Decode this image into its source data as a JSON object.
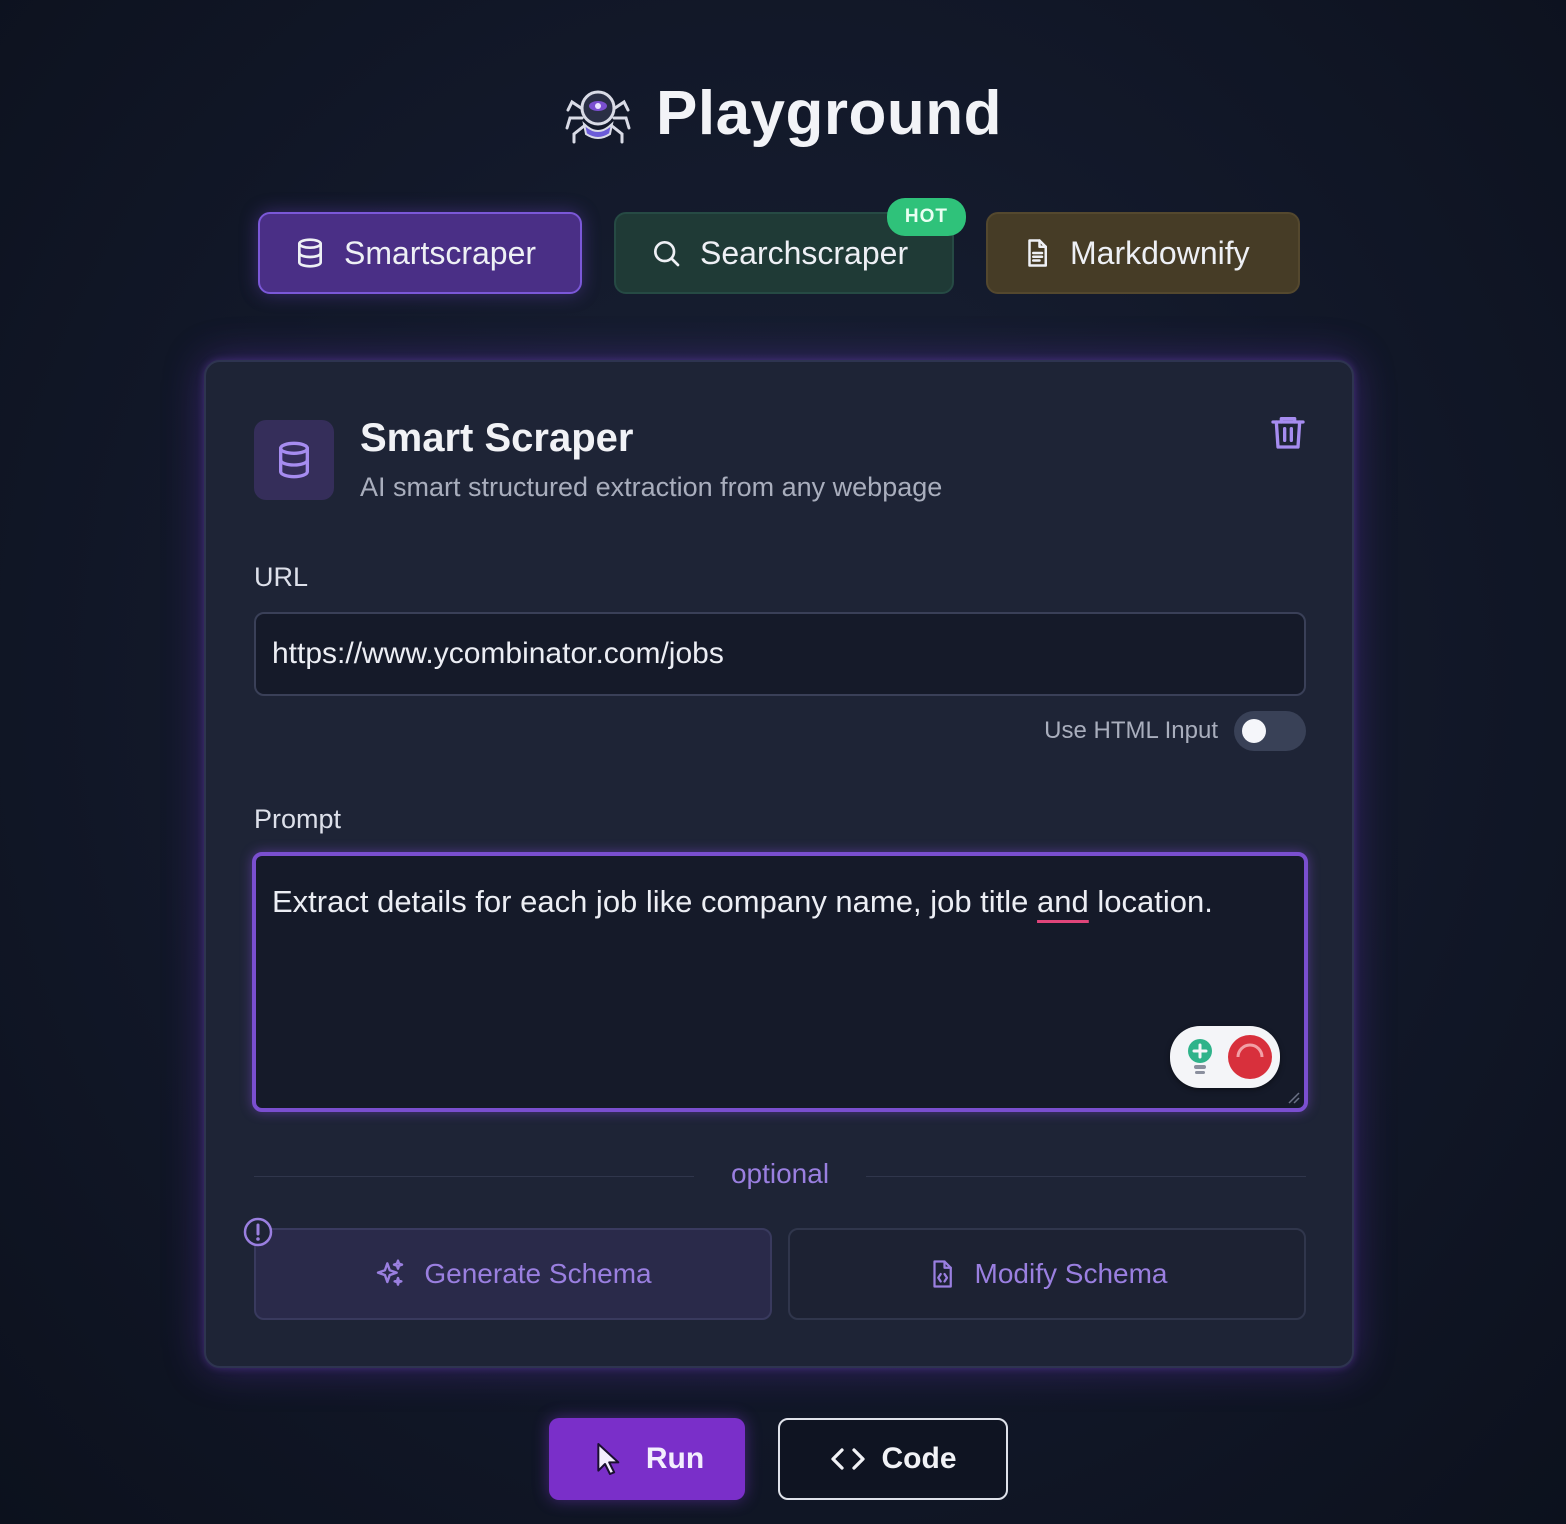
{
  "header": {
    "title": "Playground",
    "logo_icon": "spider-robot-icon"
  },
  "tabs": [
    {
      "label": "Smartscraper",
      "icon": "database-icon",
      "active": true,
      "color": "#4a2f86"
    },
    {
      "label": "Searchscraper",
      "icon": "search-icon",
      "active": false,
      "badge": "HOT",
      "color": "#1f3a36"
    },
    {
      "label": "Markdownify",
      "icon": "document-icon",
      "active": false,
      "color": "#463c26"
    }
  ],
  "card": {
    "title": "Smart Scraper",
    "subtitle": "AI smart structured extraction from any webpage",
    "icon": "database-icon",
    "delete_icon": "trash-icon",
    "url": {
      "label": "URL",
      "value": "https://www.ycombinator.com/jobs"
    },
    "html_toggle": {
      "label": "Use HTML Input",
      "on": false
    },
    "prompt": {
      "label": "Prompt",
      "text_before": "Extract details for each job like company name, job title ",
      "underlined_word": "and",
      "text_after": " location."
    },
    "divider_label": "optional",
    "generate_schema_label": "Generate Schema",
    "modify_schema_label": "Modify Schema"
  },
  "actions": {
    "run_label": "Run",
    "code_label": "Code"
  },
  "colors": {
    "accent": "#7a2fc9",
    "accent_light": "#9a7fe0",
    "hot_badge": "#2fc27a",
    "background": "#121829"
  }
}
